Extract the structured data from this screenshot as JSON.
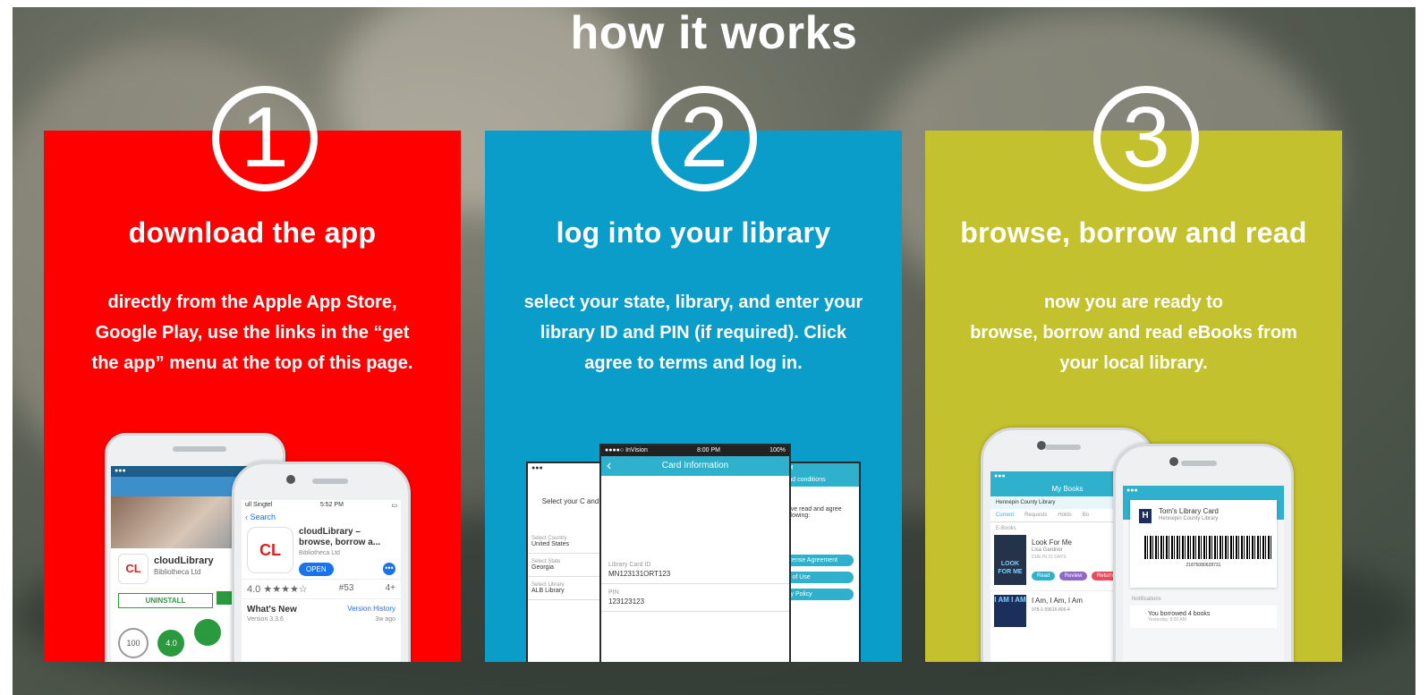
{
  "title": "how it works",
  "colors": {
    "step1": "#ff0000",
    "step2": "#0a9dc9",
    "step3": "#c3c12d"
  },
  "steps": [
    {
      "number": "1",
      "heading": "download the app",
      "lines": [
        "directly from the Apple App Store,",
        "Google Play, use the links in the “get",
        "the app” menu at the top of this page."
      ]
    },
    {
      "number": "2",
      "heading": "log into your library",
      "lines": [
        "select your state, library, and enter your",
        "library ID and PIN (if required). Click",
        "agree to terms and log in."
      ]
    },
    {
      "number": "3",
      "heading": "browse, borrow and read",
      "lines": [
        "now you are ready to",
        "browse, borrow and read eBooks from",
        "your local library."
      ]
    }
  ],
  "phone1": {
    "back_status": "",
    "front_status": "ull Singtel",
    "front_time": "5:52 PM",
    "search_label": "Search",
    "app_name": "cloudLibrary",
    "app_title": "cloudLibrary – browse, borrow a...",
    "developer": "Bibliotheca Ltd",
    "logo_text": "CL",
    "open_label": "OPEN",
    "uninstall_label": "UNINSTALL",
    "rating": "4.0",
    "stars": "★★★★☆",
    "rank": "#53",
    "age": "4+",
    "whats_new": "What's New",
    "version_history": "Version History",
    "version": "Version 3.3.6",
    "ago": "3w ago",
    "bottom_stat": "100",
    "bottom_rating": "4.0"
  },
  "phone2": {
    "carrier": "●●●●○ InVision",
    "time": "8:00 PM",
    "battery": "100%",
    "header": "Card Information",
    "left_title": "Select your C and L",
    "country_label": "Select Country",
    "country_value": "United States",
    "state_label": "Select State",
    "state_value": "Georgia",
    "library_label": "Select Library",
    "library_value": "ALB Library",
    "card_label": "Library Card ID",
    "card_value": "MN123131ORT123",
    "pin_label": "PIN",
    "pin_value": "123123123",
    "right_header": "s and conditions",
    "right_text": "have read and agree following:",
    "btn1": "icense Agreement",
    "btn2": "s of Use",
    "btn3": "cy Policy"
  },
  "phone3": {
    "left_header": "My Books",
    "left_library": "Hennepin County Library",
    "tabs": [
      "Current",
      "Requests",
      "Holds",
      "Bo"
    ],
    "section": "E-Books",
    "book1_title": "Look For Me",
    "book1_author": "Lisa Gardner",
    "book1_due": "DUE IN 21 DAYS",
    "book1_cover": "LOOK FOR ME",
    "book1_buttons": [
      "Read",
      "Review",
      "Return"
    ],
    "book2_title": "I Am, I Am, I Am",
    "book2_cover": "I AM I AM",
    "book2_meta": "978-1-59616-806-4",
    "card_name": "Tom's Library Card",
    "card_library": "Hennepin County Library",
    "barcode_number": "21875080628731",
    "notifications": "Notifications",
    "notice": "You borrowed 4 books",
    "notice_sub": "Yesterday, 8:00 AM"
  }
}
